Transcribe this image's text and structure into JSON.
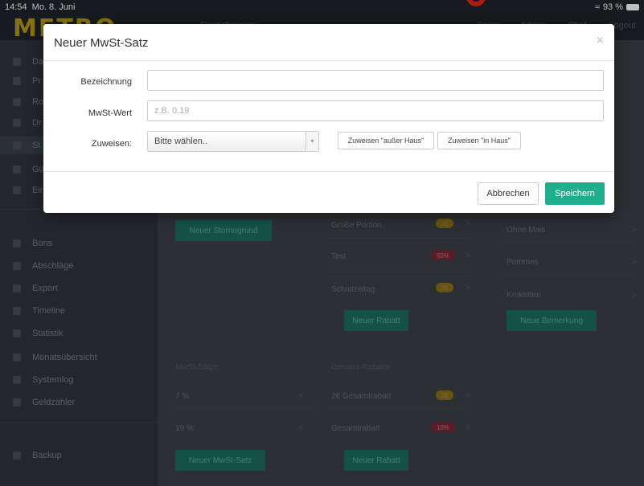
{
  "status_bar": {
    "time": "14:54",
    "date": "Mo. 8. Juni",
    "battery": "93 %"
  },
  "topnav": {
    "logo": "METRO",
    "links": [
      "Einstellungen",
      "Sepp",
      "Admin",
      "Chef",
      "Logout"
    ]
  },
  "sidebar": {
    "items_top": [
      "Da",
      "Pr",
      "Ro",
      "Dr",
      "St",
      "Gü",
      "Ein"
    ],
    "items": [
      "Bons",
      "Abschläge",
      "Export",
      "Timeline",
      "Statistik",
      "Monatsübersicht",
      "Systemlog",
      "Geldzähler"
    ],
    "section_label": "",
    "backup": "Backup"
  },
  "content": {
    "storno_button": "Neuer Stornogrund",
    "rabatte_rows": [
      {
        "label": "Große Portion",
        "badge": "1€"
      },
      {
        "label": "Test",
        "badge": "50%"
      },
      {
        "label": "Schnitzeltag",
        "badge": "2€"
      }
    ],
    "rabatt_button": "Neuer Rabatt",
    "bemerkungen_rows": [
      "Ohne Mais",
      "Pommes",
      "Kroketten"
    ],
    "bemerkung_button": "Neue Bemerkung",
    "mwst_title": "MwSt-Sätze",
    "mwst_rows": [
      "7 %",
      "19 %"
    ],
    "mwst_button": "Neuer MwSt-Satz",
    "gesamt_title": "Gesamt-Rabatte",
    "gesamt_rows": [
      {
        "label": "2€ Gesamtrabatt",
        "badge": "2€"
      },
      {
        "label": "Gesamtrabatt",
        "badge": "10%"
      }
    ],
    "gesamt_button": "Neuer Rabatt"
  },
  "modal": {
    "title": "Neuer MwSt-Satz",
    "close_symbol": "×",
    "fields": {
      "bezeichnung_label": "Bezeichnung",
      "bezeichnung_value": "",
      "mwst_label": "MwSt-Wert",
      "mwst_placeholder": "z.B. 0.19",
      "zuweisen_label": "Zuweisen:",
      "zuweisen_selected": "Bitte wählen..",
      "btn_ausser_haus": "Zuweisen \"außer Haus\"",
      "btn_in_haus": "Zuweisen \"in Haus\""
    },
    "cancel_label": "Abbrechen",
    "save_label": "Speichern"
  },
  "colors": {
    "primary": "#1fae8e",
    "sidebar": "#2f343a",
    "logo": "#b39a16"
  }
}
